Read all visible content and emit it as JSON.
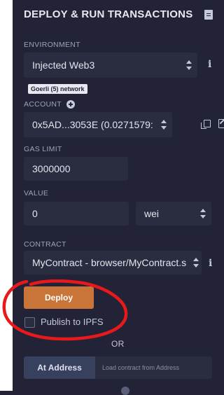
{
  "panel": {
    "title": "DEPLOY & RUN TRANSACTIONS"
  },
  "environment": {
    "label": "ENVIRONMENT",
    "value": "Injected Web3",
    "network_badge": "Goerli (5) network"
  },
  "account": {
    "label": "ACCOUNT",
    "value": "0x5AD...3053E (0.0271579:"
  },
  "gas_limit": {
    "label": "GAS LIMIT",
    "value": "3000000"
  },
  "value": {
    "label": "VALUE",
    "amount": "0",
    "unit": "wei"
  },
  "contract": {
    "label": "CONTRACT",
    "value": "MyContract - browser/MyContract.s"
  },
  "deploy": {
    "button_label": "Deploy",
    "publish_label": "Publish to IPFS",
    "publish_checked": false
  },
  "or_label": "OR",
  "at_address": {
    "button_label": "At Address",
    "placeholder": "Load contract from Address"
  },
  "colors": {
    "background": "#222336",
    "input_bg": "#2a2c3f",
    "deploy_button": "#c97539",
    "annotation_circle": "#e8191b"
  },
  "icons": {
    "title": "file-document-icon",
    "environment_info": "info-icon",
    "account_add": "plus-circle-icon",
    "account_copy": "copy-icon",
    "account_edit": "edit-icon",
    "contract_info": "info-icon"
  }
}
